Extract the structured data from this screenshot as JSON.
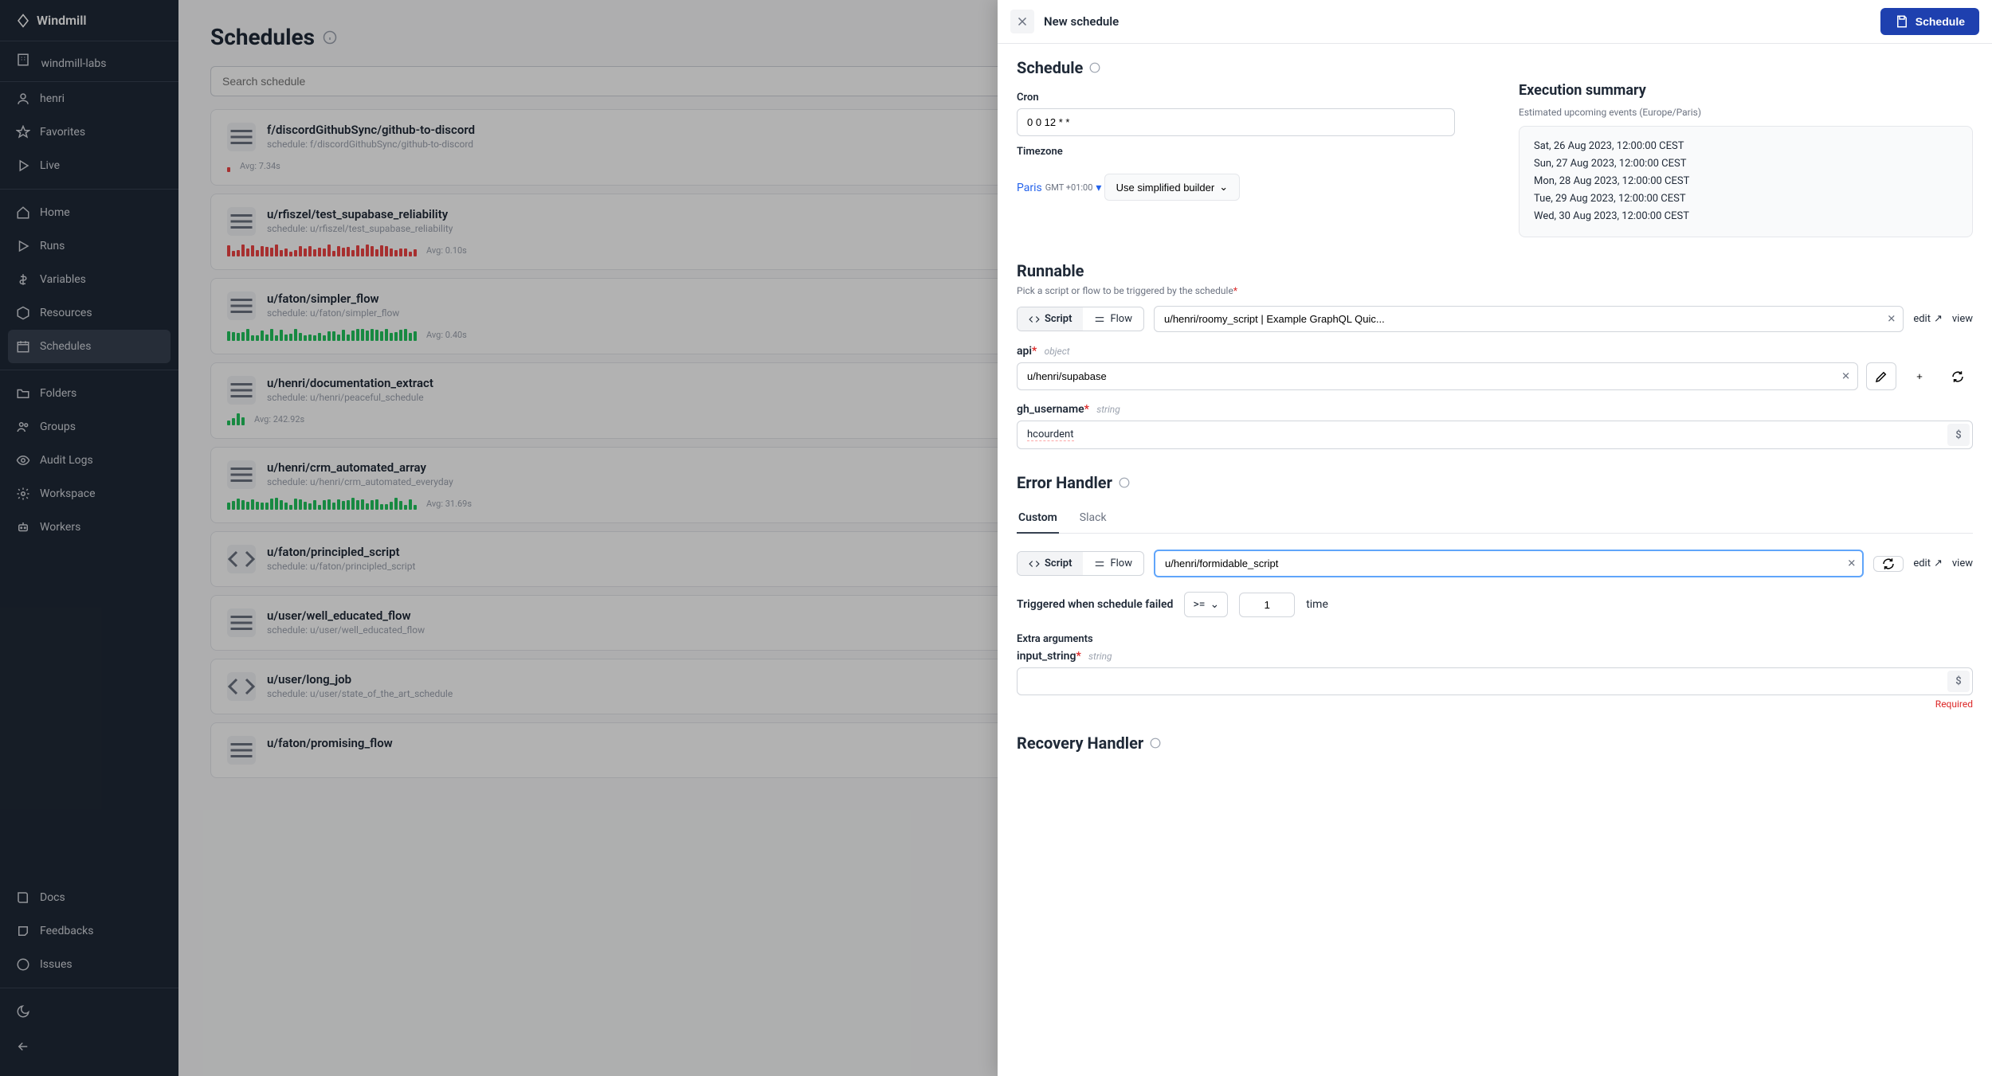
{
  "app": {
    "name": "Windmill",
    "org": "windmill-labs",
    "user": "henri"
  },
  "sidebar": {
    "favorites": "Favorites",
    "live": "Live",
    "home": "Home",
    "runs": "Runs",
    "variables": "Variables",
    "resources": "Resources",
    "schedules": "Schedules",
    "folders": "Folders",
    "groups": "Groups",
    "audit": "Audit Logs",
    "workspace": "Workspace",
    "workers": "Workers",
    "docs": "Docs",
    "feedbacks": "Feedbacks",
    "issues": "Issues"
  },
  "page": {
    "title": "Schedules",
    "search_placeholder": "Search schedule"
  },
  "schedules": [
    {
      "name": "f/discordGithubSync/github-to-discord",
      "sub": "schedule: f/discordGithubSync/github-to-discord",
      "avg": "Avg: 7.34s",
      "bar_color": "#ef4444",
      "bar_count": 1
    },
    {
      "name": "u/rfiszel/test_supabase_reliability",
      "sub": "schedule: u/rfiszel/test_supabase_reliability",
      "avg": "Avg: 0.10s",
      "bar_color": "#ef4444",
      "bar_count": 40
    },
    {
      "name": "u/faton/simpler_flow",
      "sub": "schedule: u/faton/simpler_flow",
      "avg": "Avg: 0.40s",
      "bar_color": "#22c55e",
      "bar_count": 40
    },
    {
      "name": "u/henri/documentation_extract",
      "sub": "schedule: u/henri/peaceful_schedule",
      "avg": "Avg: 242.92s",
      "bar_color": "#22c55e",
      "bar_count": 4
    },
    {
      "name": "u/henri/crm_automated_array",
      "sub": "schedule: u/henri/crm_automated_everyday",
      "avg": "Avg: 31.69s",
      "bar_color": "#22c55e",
      "bar_count": 40
    },
    {
      "name": "u/faton/principled_script",
      "sub": "schedule: u/faton/principled_script",
      "avg": "",
      "bar_color": "",
      "bar_count": 0,
      "type": "script"
    },
    {
      "name": "u/user/well_educated_flow",
      "sub": "schedule: u/user/well_educated_flow",
      "avg": "",
      "bar_color": "",
      "bar_count": 0
    },
    {
      "name": "u/user/long_job",
      "sub": "schedule: u/user/state_of_the_art_schedule",
      "avg": "",
      "bar_color": "",
      "bar_count": 0,
      "type": "script"
    },
    {
      "name": "u/faton/promising_flow",
      "sub": "",
      "avg": "",
      "bar_color": "",
      "bar_count": 0
    }
  ],
  "drawer": {
    "title": "New schedule",
    "save_btn": "Schedule",
    "schedule_section": "Schedule",
    "cron_label": "Cron",
    "cron_value": "0 0 12 * *",
    "timezone_label": "Timezone",
    "timezone": "Paris",
    "timezone_offset": "GMT +01:00",
    "builder_btn": "Use simplified builder",
    "exec_title": "Execution summary",
    "exec_sub": "Estimated upcoming events (Europe/Paris)",
    "exec_events": [
      "Sat, 26 Aug 2023, 12:00:00 CEST",
      "Sun, 27 Aug 2023, 12:00:00 CEST",
      "Mon, 28 Aug 2023, 12:00:00 CEST",
      "Tue, 29 Aug 2023, 12:00:00 CEST",
      "Wed, 30 Aug 2023, 12:00:00 CEST"
    ],
    "runnable_title": "Runnable",
    "runnable_helper": "Pick a script or flow to be triggered by the schedule",
    "script_label": "Script",
    "flow_label": "Flow",
    "runnable_value": "u/henri/roomy_script | Example GraphQL Quic...",
    "edit": "edit",
    "view": "view",
    "args": {
      "api": {
        "label": "api",
        "type": "object",
        "value": "u/henri/supabase"
      },
      "gh_username": {
        "label": "gh_username",
        "type": "string",
        "value": "hcourdent"
      }
    },
    "error_handler": "Error Handler",
    "tabs": {
      "custom": "Custom",
      "slack": "Slack"
    },
    "error_script": "u/henri/formidable_script",
    "trigger_label": "Triggered when schedule failed",
    "trigger_op": ">=",
    "trigger_count": "1",
    "trigger_unit": "time",
    "extra_args_label": "Extra arguments",
    "input_string": {
      "label": "input_string",
      "type": "string"
    },
    "required": "Required",
    "recovery_handler": "Recovery Handler"
  }
}
